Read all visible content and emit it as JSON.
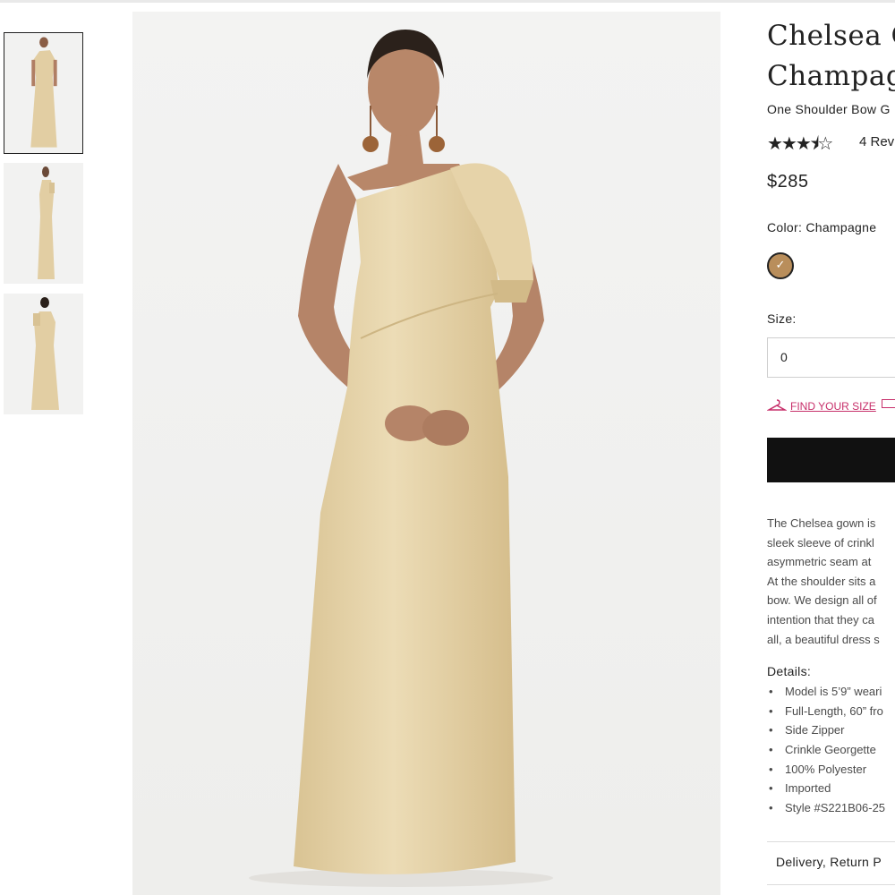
{
  "product": {
    "title_line1": "Chelsea G",
    "title_line2": "Champag",
    "subtitle": "One Shoulder Bow G",
    "rating_stars": "★★★⯨☆",
    "rating_value": 3.5,
    "reviews_text": "4 Rev",
    "price": "$285",
    "color_label": "Color: Champagne",
    "swatch_color": "#b98e5b",
    "swatch_check": "✓",
    "size_label": "Size:",
    "size_value": "0",
    "find_size": "FIND YOUR SIZE",
    "description_lines": [
      "The Chelsea gown is",
      "sleek sleeve of crinkl",
      "asymmetric seam at",
      "At the shoulder sits a",
      "bow. We design all of",
      "intention that they ca",
      "all, a beautiful dress s"
    ],
    "details_label": "Details:",
    "details": [
      "Model is 5’9” weari",
      "Full-Length, 60” fro",
      "Side Zipper",
      "Crinkle Georgette",
      "100% Polyester",
      "Imported",
      "Style #S221B06-25"
    ],
    "delivery_label": "Delivery, Return P"
  },
  "colors": {
    "accent_pink": "#c72f6a",
    "button_black": "#111111",
    "dress_gold": "#e3cfa4"
  },
  "icons": {
    "hanger": "hanger-icon",
    "measure": "measuring-tape-icon"
  }
}
